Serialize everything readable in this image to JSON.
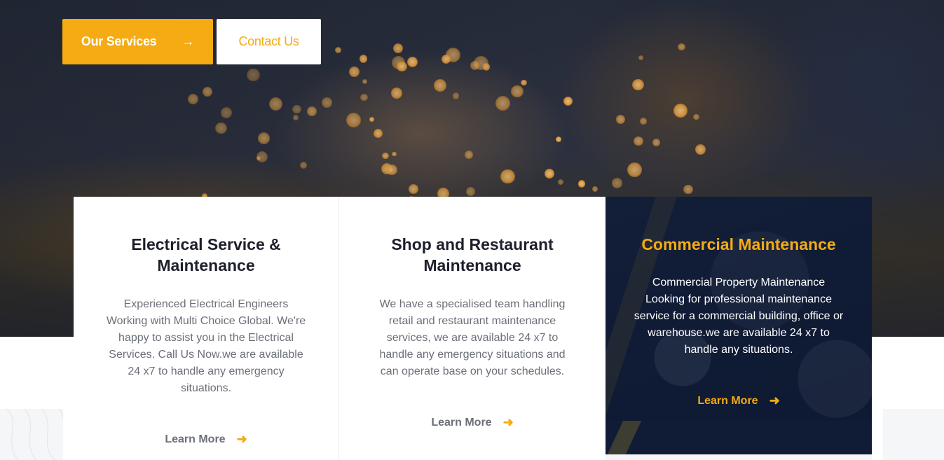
{
  "hero": {
    "primary_button_label": "Our Services",
    "primary_button_icon": "arrow-right-icon",
    "secondary_button_label": "Contact Us"
  },
  "cards": [
    {
      "title_line1": "Electrical Service &",
      "title_line2": "Maintenance",
      "description": "Experienced Electrical Engineers Working with Multi Choice Global. We're happy to assist you in the Electrical Services. Call Us Now.we are available 24 x7 to handle any emergency situations.",
      "link_label": "Learn More",
      "link_icon": "arrow-right-icon"
    },
    {
      "title_line1": "Shop and Restaurant",
      "title_line2": "Maintenance",
      "description": "We have a specialised team handling retail and restaurant maintenance services, we are available 24 x7 to handle any emergency situations and can operate base on your schedules.",
      "link_label": "Learn More",
      "link_icon": "arrow-right-icon"
    },
    {
      "title_line1": "Commercial Maintenance",
      "title_line2": "",
      "description": "Commercial Property Maintenance Looking for professional maintenance service for a commercial building, office or warehouse.we are available 24 x7 to handle any  situations.",
      "link_label": "Learn More",
      "link_icon": "arrow-right-icon"
    }
  ],
  "colors": {
    "accent": "#f5ab13",
    "heading": "#1d1f2b",
    "body_text": "#6b6f78",
    "dark_card": "#14203a"
  }
}
